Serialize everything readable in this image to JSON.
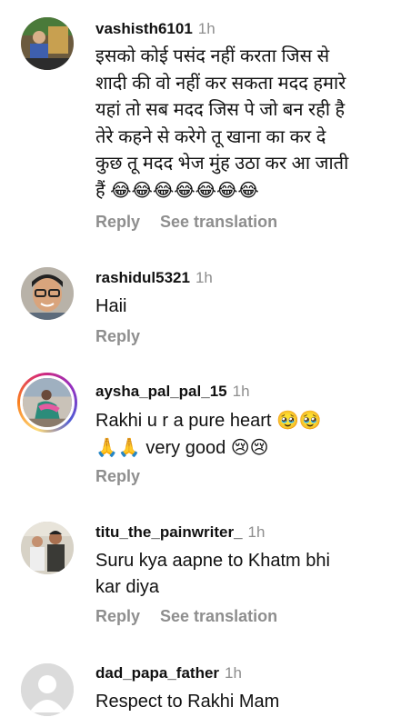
{
  "comments": [
    {
      "username": "vashisth6101",
      "time": "1h",
      "lines": [
        "इसको कोई पसंद नहीं करता जिस से",
        "शादी की वो नहीं कर सकता मदद हमारे",
        "यहां तो सब मदद जिस पे जो बन रही है",
        "तेरे कहने से करेगे तू खाना का कर दे",
        "कुछ तू मदद भेज मुंह उठा कर आ जाती",
        "हैं 😂😂😂😂😂😂😂"
      ],
      "reply": "Reply",
      "translate": "See translation"
    },
    {
      "username": "rashidul5321",
      "time": "1h",
      "lines": [
        "Haii"
      ],
      "reply": "Reply"
    },
    {
      "username": "aysha_pal_pal_15",
      "time": "1h",
      "lines": [
        "Rakhi u r a pure heart 🥹🥹",
        "🙏🙏 very good 😢😢"
      ],
      "reply": "Reply"
    },
    {
      "username": "titu_the_painwriter_",
      "time": "1h",
      "lines": [
        "Suru kya aapne to Khatm bhi",
        "kar diya"
      ],
      "reply": "Reply",
      "translate": "See translation"
    },
    {
      "username": "dad_papa_father",
      "time": "1h",
      "lines": [
        "Respect to Rakhi Mam"
      ]
    }
  ]
}
